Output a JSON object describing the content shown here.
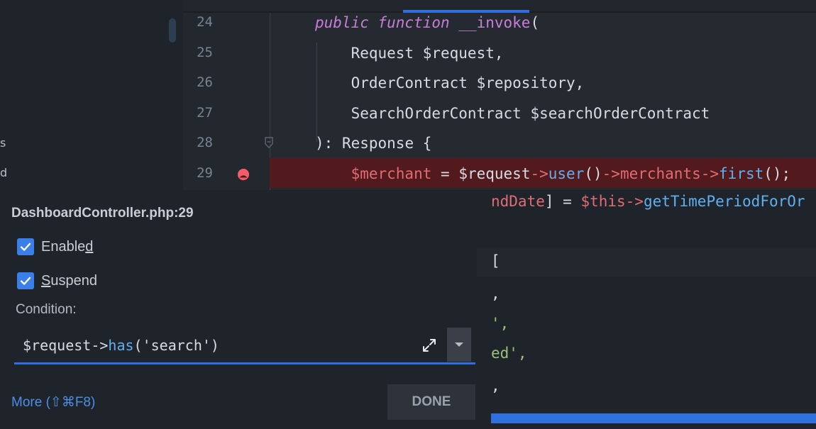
{
  "editor": {
    "lines": [
      {
        "number": "24",
        "tokens": [
          {
            "t": "public function ",
            "c": "kw"
          },
          {
            "t": "__invoke",
            "c": "fn"
          },
          {
            "t": "(",
            "c": "plain"
          }
        ]
      },
      {
        "number": "25",
        "tokens": [
          {
            "t": "    Request ",
            "c": "plain"
          },
          {
            "t": "$request",
            "c": "plain"
          },
          {
            "t": ",",
            "c": "plain"
          }
        ]
      },
      {
        "number": "26",
        "tokens": [
          {
            "t": "    OrderContract ",
            "c": "plain"
          },
          {
            "t": "$repository",
            "c": "plain"
          },
          {
            "t": ",",
            "c": "plain"
          }
        ]
      },
      {
        "number": "27",
        "tokens": [
          {
            "t": "    SearchOrderContract ",
            "c": "plain"
          },
          {
            "t": "$searchOrderContract",
            "c": "plain"
          }
        ]
      },
      {
        "number": "28",
        "tokens": [
          {
            "t": "): ",
            "c": "plain"
          },
          {
            "t": "Response ",
            "c": "plain"
          },
          {
            "t": "{",
            "c": "plain"
          }
        ]
      },
      {
        "number": "29",
        "breakpoint": true,
        "tokens": [
          {
            "t": "    $merchant",
            "c": "var"
          },
          {
            "t": " = ",
            "c": "plain"
          },
          {
            "t": "$request",
            "c": "plain"
          },
          {
            "t": "->",
            "c": "call"
          },
          {
            "t": "user",
            "c": "meth"
          },
          {
            "t": "()",
            "c": "plain"
          },
          {
            "t": "->",
            "c": "call"
          },
          {
            "t": "merchants",
            "c": "call"
          },
          {
            "t": "->",
            "c": "call"
          },
          {
            "t": "first",
            "c": "meth"
          },
          {
            "t": "();",
            "c": "plain"
          }
        ]
      }
    ],
    "right_fragments": [
      {
        "tokens": [
          {
            "t": "ndDate",
            "c": "var"
          },
          {
            "t": "] = ",
            "c": "plain"
          },
          {
            "t": "$this",
            "c": "var"
          },
          {
            "t": "->",
            "c": "call"
          },
          {
            "t": "getTimePeriodForOr",
            "c": "meth"
          }
        ]
      },
      {
        "tokens": [
          {
            "t": "[",
            "c": "plain"
          }
        ]
      },
      {
        "tokens": [
          {
            "t": ",",
            "c": "plain"
          }
        ]
      },
      {
        "tokens": [
          {
            "t": "',",
            "c": "str"
          }
        ]
      },
      {
        "tokens": [
          {
            "t": "ed',",
            "c": "str"
          }
        ]
      },
      {
        "tokens": [
          {
            "t": ",",
            "c": "plain"
          }
        ]
      }
    ],
    "left_glyphs": [
      "s",
      "d"
    ]
  },
  "popup": {
    "title": "DashboardController.php:29",
    "enabled_label": "Enabled",
    "suspend_label": "Suspend",
    "condition_label": "Condition:",
    "condition_tokens": [
      {
        "t": "$request",
        "c": "plain"
      },
      {
        "t": "->",
        "c": "plain"
      },
      {
        "t": "has",
        "c": "meth"
      },
      {
        "t": "('search')",
        "c": "plain"
      }
    ],
    "more_label": "More (⇧⌘F8)",
    "done_label": "DONE",
    "enabled_checked": true,
    "suspend_checked": true
  },
  "colors": {
    "accent": "#2f6fe0",
    "breakpoint_bg": "#521a1c",
    "breakpoint_dot": "#f25d68"
  }
}
